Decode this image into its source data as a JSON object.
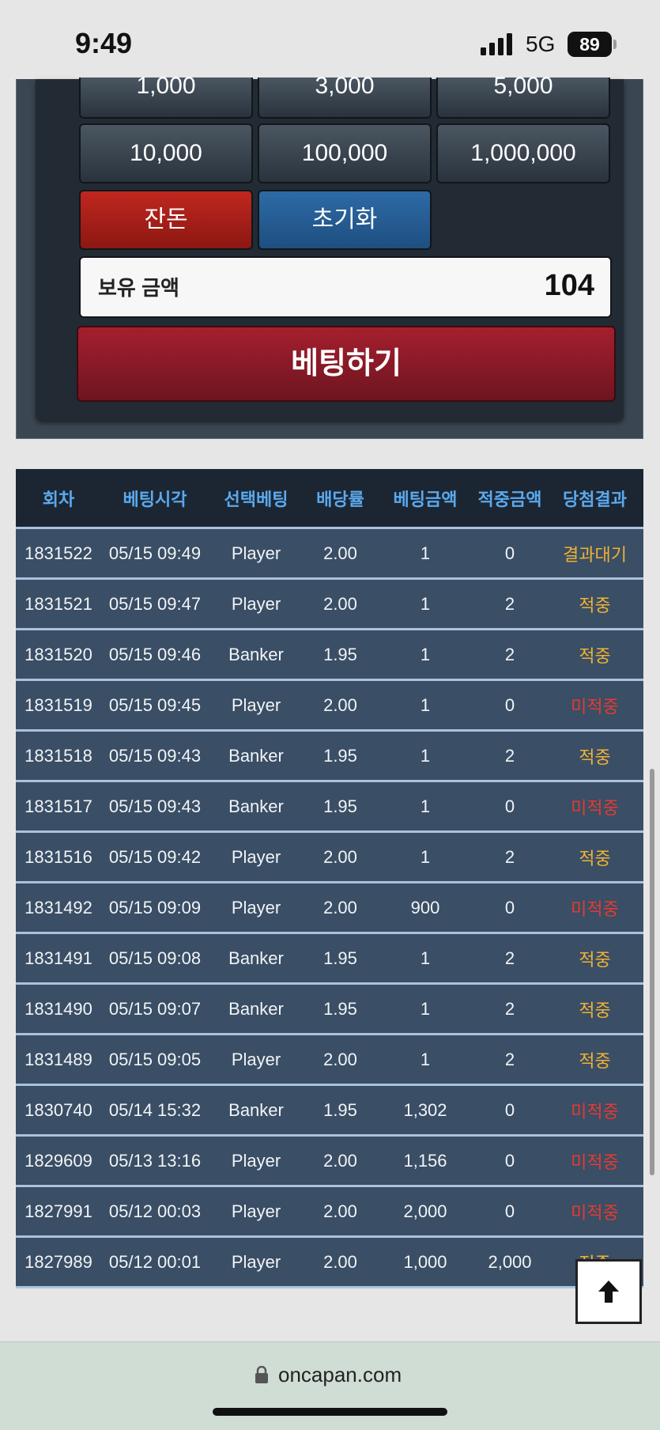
{
  "status_bar": {
    "time": "9:49",
    "network": "5G",
    "battery": "89"
  },
  "bet_panel": {
    "chips_top": [
      "1,000",
      "3,000",
      "5,000"
    ],
    "chips_mid": [
      "10,000",
      "100,000",
      "1,000,000"
    ],
    "change_label": "잔돈",
    "reset_label": "초기화",
    "balance_label": "보유 금액",
    "balance_value": "104",
    "submit_label": "베팅하기"
  },
  "history": {
    "columns": [
      "회차",
      "베팅시각",
      "선택베팅",
      "배당률",
      "베팅금액",
      "적중금액",
      "당첨결과"
    ],
    "rows": [
      [
        "1831522",
        "05/15 09:49",
        "Player",
        "2.00",
        "1",
        "0",
        "결과대기"
      ],
      [
        "1831521",
        "05/15 09:47",
        "Player",
        "2.00",
        "1",
        "2",
        "적중"
      ],
      [
        "1831520",
        "05/15 09:46",
        "Banker",
        "1.95",
        "1",
        "2",
        "적중"
      ],
      [
        "1831519",
        "05/15 09:45",
        "Player",
        "2.00",
        "1",
        "0",
        "미적중"
      ],
      [
        "1831518",
        "05/15 09:43",
        "Banker",
        "1.95",
        "1",
        "2",
        "적중"
      ],
      [
        "1831517",
        "05/15 09:43",
        "Banker",
        "1.95",
        "1",
        "0",
        "미적중"
      ],
      [
        "1831516",
        "05/15 09:42",
        "Player",
        "2.00",
        "1",
        "2",
        "적중"
      ],
      [
        "1831492",
        "05/15 09:09",
        "Player",
        "2.00",
        "900",
        "0",
        "미적중"
      ],
      [
        "1831491",
        "05/15 09:08",
        "Banker",
        "1.95",
        "1",
        "2",
        "적중"
      ],
      [
        "1831490",
        "05/15 09:07",
        "Banker",
        "1.95",
        "1",
        "2",
        "적중"
      ],
      [
        "1831489",
        "05/15 09:05",
        "Player",
        "2.00",
        "1",
        "2",
        "적중"
      ],
      [
        "1830740",
        "05/14 15:32",
        "Banker",
        "1.95",
        "1,302",
        "0",
        "미적중"
      ],
      [
        "1829609",
        "05/13 13:16",
        "Player",
        "2.00",
        "1,156",
        "0",
        "미적중"
      ],
      [
        "1827991",
        "05/12 00:03",
        "Player",
        "2.00",
        "2,000",
        "0",
        "미적중"
      ],
      [
        "1827989",
        "05/12 00:01",
        "Player",
        "2.00",
        "1,000",
        "2,000",
        "적중"
      ]
    ]
  },
  "browser": {
    "url": "oncapan.com"
  },
  "colors": {
    "accent_header": "#5aa9ee",
    "result_pending": "#f0b233",
    "result_win": "#f0b233",
    "result_lose": "#e53a30"
  },
  "icons": {
    "signal": "signal-icon",
    "battery": "battery-icon",
    "back_to_top": "arrow-up-icon",
    "lock": "lock-icon"
  }
}
